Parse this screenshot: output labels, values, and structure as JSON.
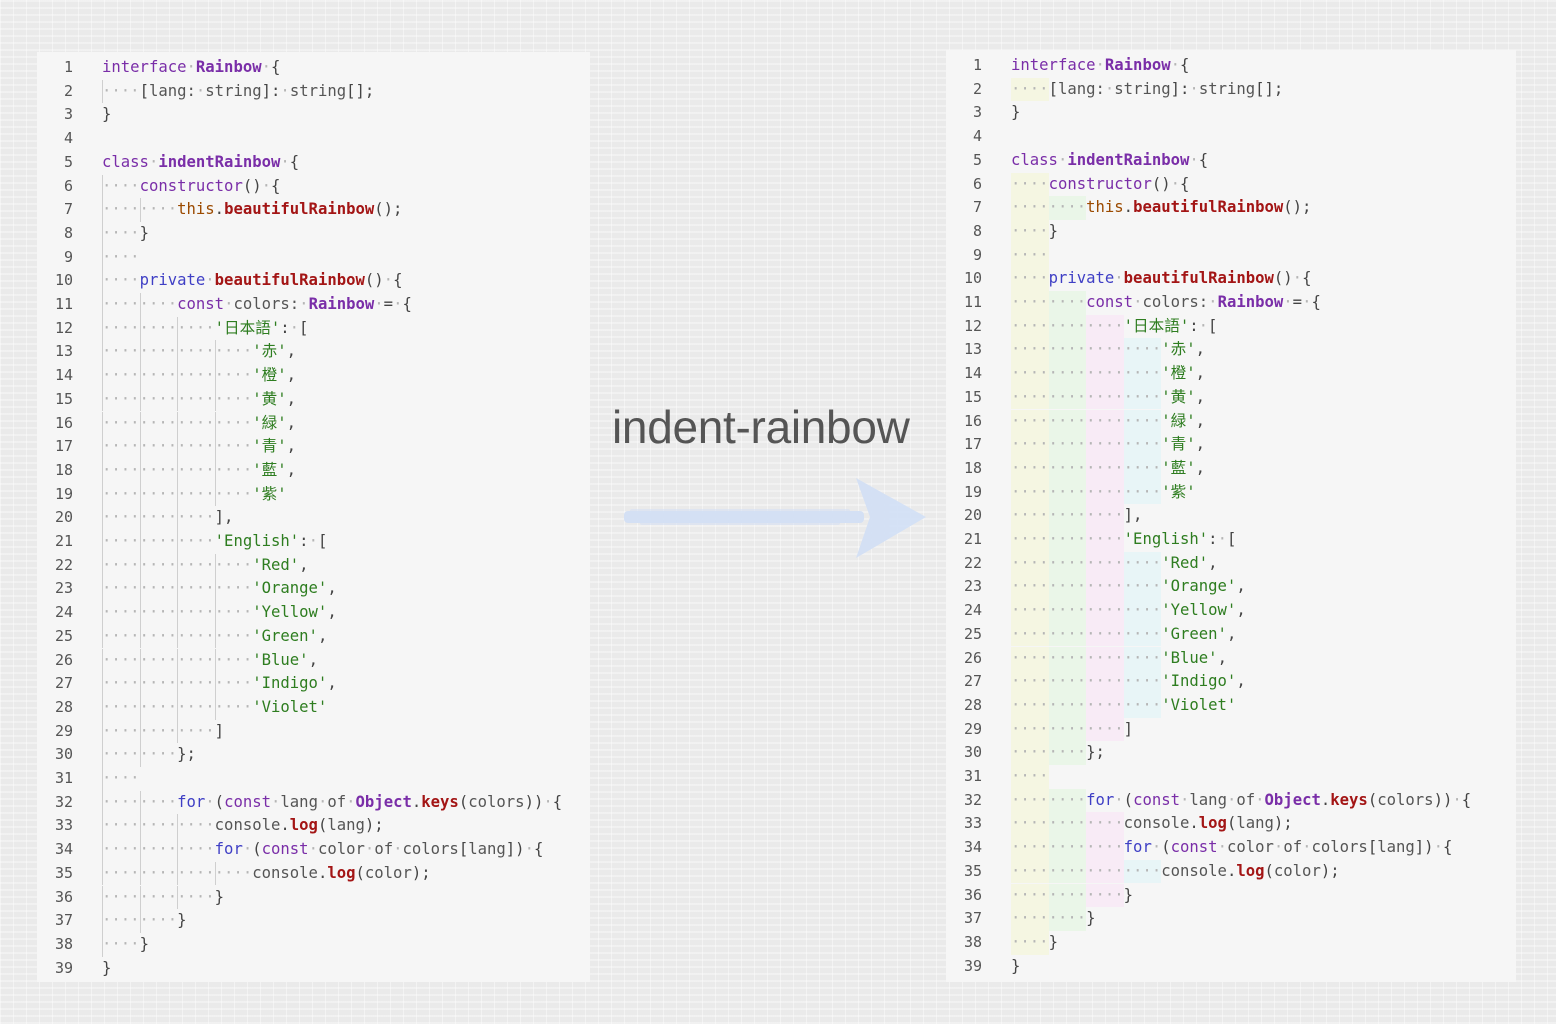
{
  "title": "indent-rainbow",
  "colors": {
    "band1": "#f5f6e2",
    "band2": "#eaf6e8",
    "band3": "#f8ebf6",
    "band4": "#e8f5f7",
    "arrow": "#d3e0f5",
    "keyword": "#3f3fc5",
    "type": "#7a2ea8",
    "function": "#a31515",
    "string": "#2e7d20"
  },
  "code": {
    "lines": [
      {
        "n": "1",
        "indent": 0,
        "t": [
          [
            "kp",
            "interface"
          ],
          [
            "p",
            " "
          ],
          [
            "ty",
            "Rainbow"
          ],
          [
            "p",
            " "
          ],
          [
            "pu",
            "{"
          ]
        ]
      },
      {
        "n": "2",
        "indent": 1,
        "t": [
          [
            "pu",
            "["
          ],
          [
            "pl",
            "lang:"
          ],
          [
            "p",
            " "
          ],
          [
            "pl",
            "string"
          ],
          [
            "pu",
            "]:"
          ],
          [
            "p",
            " "
          ],
          [
            "pl",
            "string"
          ],
          [
            "pu",
            "[];"
          ]
        ]
      },
      {
        "n": "3",
        "indent": 0,
        "t": [
          [
            "pu",
            "}"
          ]
        ]
      },
      {
        "n": "4",
        "indent": 0,
        "t": []
      },
      {
        "n": "5",
        "indent": 0,
        "t": [
          [
            "kp",
            "class"
          ],
          [
            "p",
            " "
          ],
          [
            "ty",
            "indentRainbow"
          ],
          [
            "p",
            " "
          ],
          [
            "pu",
            "{"
          ]
        ]
      },
      {
        "n": "6",
        "indent": 1,
        "t": [
          [
            "kp",
            "constructor"
          ],
          [
            "pu",
            "()"
          ],
          [
            "p",
            " "
          ],
          [
            "pu",
            "{"
          ]
        ]
      },
      {
        "n": "7",
        "indent": 2,
        "t": [
          [
            "th",
            "this"
          ],
          [
            "pu",
            "."
          ],
          [
            "fn",
            "beautifulRainbow"
          ],
          [
            "pu",
            "();"
          ]
        ]
      },
      {
        "n": "8",
        "indent": 1,
        "t": [
          [
            "pu",
            "}"
          ]
        ]
      },
      {
        "n": "9",
        "indent": 1,
        "t": []
      },
      {
        "n": "10",
        "indent": 1,
        "t": [
          [
            "kw",
            "private"
          ],
          [
            "p",
            " "
          ],
          [
            "fn",
            "beautifulRainbow"
          ],
          [
            "pu",
            "()"
          ],
          [
            "p",
            " "
          ],
          [
            "pu",
            "{"
          ]
        ]
      },
      {
        "n": "11",
        "indent": 2,
        "t": [
          [
            "kp",
            "const"
          ],
          [
            "p",
            " "
          ],
          [
            "pl",
            "colors:"
          ],
          [
            "p",
            " "
          ],
          [
            "ty",
            "Rainbow"
          ],
          [
            "p",
            " "
          ],
          [
            "pu",
            "="
          ],
          [
            "p",
            " "
          ],
          [
            "pu",
            "{"
          ]
        ]
      },
      {
        "n": "12",
        "indent": 3,
        "t": [
          [
            "str",
            "'日本語'"
          ],
          [
            "pu",
            ":"
          ],
          [
            "p",
            " "
          ],
          [
            "pu",
            "["
          ]
        ]
      },
      {
        "n": "13",
        "indent": 4,
        "t": [
          [
            "str",
            "'赤'"
          ],
          [
            "pu",
            ","
          ]
        ]
      },
      {
        "n": "14",
        "indent": 4,
        "t": [
          [
            "str",
            "'橙'"
          ],
          [
            "pu",
            ","
          ]
        ]
      },
      {
        "n": "15",
        "indent": 4,
        "t": [
          [
            "str",
            "'黄'"
          ],
          [
            "pu",
            ","
          ]
        ]
      },
      {
        "n": "16",
        "indent": 4,
        "t": [
          [
            "str",
            "'緑'"
          ],
          [
            "pu",
            ","
          ]
        ]
      },
      {
        "n": "17",
        "indent": 4,
        "t": [
          [
            "str",
            "'青'"
          ],
          [
            "pu",
            ","
          ]
        ]
      },
      {
        "n": "18",
        "indent": 4,
        "t": [
          [
            "str",
            "'藍'"
          ],
          [
            "pu",
            ","
          ]
        ]
      },
      {
        "n": "19",
        "indent": 4,
        "t": [
          [
            "str",
            "'紫'"
          ]
        ]
      },
      {
        "n": "20",
        "indent": 3,
        "t": [
          [
            "pu",
            "],"
          ]
        ]
      },
      {
        "n": "21",
        "indent": 3,
        "t": [
          [
            "str",
            "'English'"
          ],
          [
            "pu",
            ":"
          ],
          [
            "p",
            " "
          ],
          [
            "pu",
            "["
          ]
        ]
      },
      {
        "n": "22",
        "indent": 4,
        "t": [
          [
            "str",
            "'Red'"
          ],
          [
            "pu",
            ","
          ]
        ]
      },
      {
        "n": "23",
        "indent": 4,
        "t": [
          [
            "str",
            "'Orange'"
          ],
          [
            "pu",
            ","
          ]
        ]
      },
      {
        "n": "24",
        "indent": 4,
        "t": [
          [
            "str",
            "'Yellow'"
          ],
          [
            "pu",
            ","
          ]
        ]
      },
      {
        "n": "25",
        "indent": 4,
        "t": [
          [
            "str",
            "'Green'"
          ],
          [
            "pu",
            ","
          ]
        ]
      },
      {
        "n": "26",
        "indent": 4,
        "t": [
          [
            "str",
            "'Blue'"
          ],
          [
            "pu",
            ","
          ]
        ]
      },
      {
        "n": "27",
        "indent": 4,
        "t": [
          [
            "str",
            "'Indigo'"
          ],
          [
            "pu",
            ","
          ]
        ]
      },
      {
        "n": "28",
        "indent": 4,
        "t": [
          [
            "str",
            "'Violet'"
          ]
        ]
      },
      {
        "n": "29",
        "indent": 3,
        "t": [
          [
            "pu",
            "]"
          ]
        ]
      },
      {
        "n": "30",
        "indent": 2,
        "t": [
          [
            "pu",
            "};"
          ]
        ]
      },
      {
        "n": "31",
        "indent": 1,
        "t": []
      },
      {
        "n": "32",
        "indent": 2,
        "t": [
          [
            "kw",
            "for"
          ],
          [
            "p",
            " "
          ],
          [
            "pu",
            "("
          ],
          [
            "kp",
            "const"
          ],
          [
            "p",
            " "
          ],
          [
            "pl",
            "lang"
          ],
          [
            "p",
            " "
          ],
          [
            "pl",
            "of"
          ],
          [
            "p",
            " "
          ],
          [
            "ty",
            "Object"
          ],
          [
            "pu",
            "."
          ],
          [
            "fn",
            "keys"
          ],
          [
            "pu",
            "("
          ],
          [
            "pl",
            "colors"
          ],
          [
            "pu",
            "))"
          ],
          [
            "p",
            " "
          ],
          [
            "pu",
            "{"
          ]
        ]
      },
      {
        "n": "33",
        "indent": 3,
        "t": [
          [
            "pl",
            "console"
          ],
          [
            "pu",
            "."
          ],
          [
            "fn",
            "log"
          ],
          [
            "pu",
            "("
          ],
          [
            "pl",
            "lang"
          ],
          [
            "pu",
            ");"
          ]
        ]
      },
      {
        "n": "34",
        "indent": 3,
        "t": [
          [
            "kw",
            "for"
          ],
          [
            "p",
            " "
          ],
          [
            "pu",
            "("
          ],
          [
            "kp",
            "const"
          ],
          [
            "p",
            " "
          ],
          [
            "pl",
            "color"
          ],
          [
            "p",
            " "
          ],
          [
            "pl",
            "of"
          ],
          [
            "p",
            " "
          ],
          [
            "pl",
            "colors"
          ],
          [
            "pu",
            "["
          ],
          [
            "pl",
            "lang"
          ],
          [
            "pu",
            "])"
          ],
          [
            "p",
            " "
          ],
          [
            "pu",
            "{"
          ]
        ]
      },
      {
        "n": "35",
        "indent": 4,
        "t": [
          [
            "pl",
            "console"
          ],
          [
            "pu",
            "."
          ],
          [
            "fn",
            "log"
          ],
          [
            "pu",
            "("
          ],
          [
            "pl",
            "color"
          ],
          [
            "pu",
            ");"
          ]
        ]
      },
      {
        "n": "36",
        "indent": 3,
        "t": [
          [
            "pu",
            "}"
          ]
        ]
      },
      {
        "n": "37",
        "indent": 2,
        "t": [
          [
            "pu",
            "}"
          ]
        ]
      },
      {
        "n": "38",
        "indent": 1,
        "t": [
          [
            "pu",
            "}"
          ]
        ]
      },
      {
        "n": "39",
        "indent": 0,
        "t": [
          [
            "pu",
            "}"
          ]
        ]
      }
    ]
  }
}
